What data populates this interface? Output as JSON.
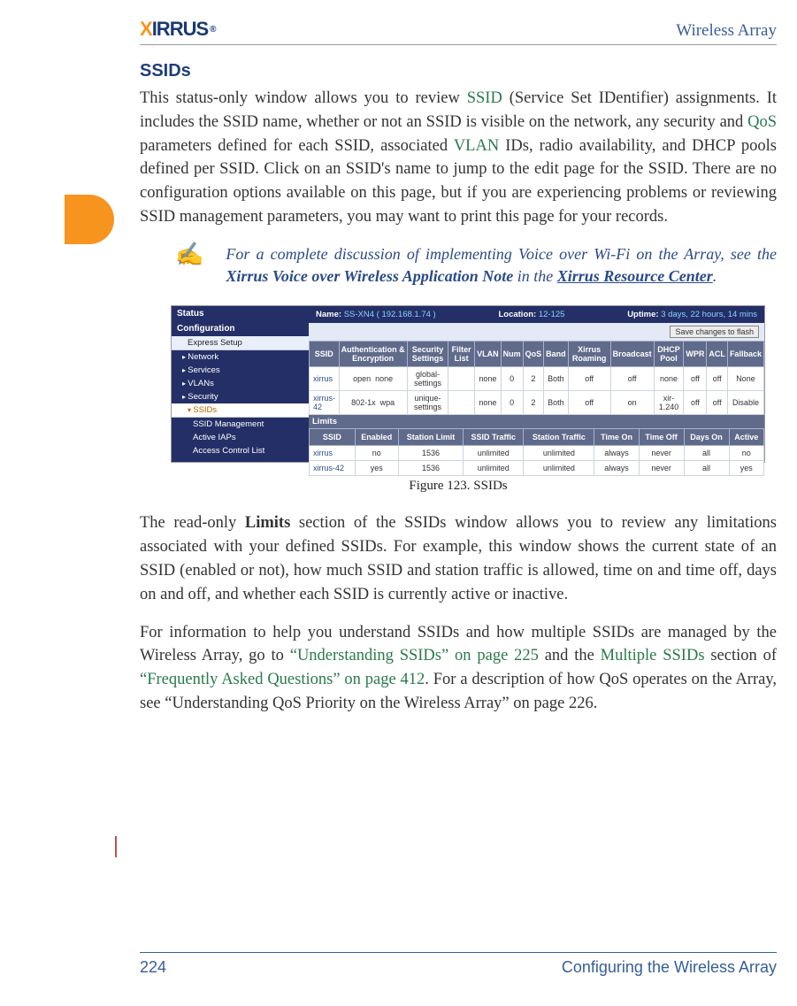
{
  "header": {
    "logo_prefix": "X",
    "logo_text": "IRRUS",
    "logo_sup": "®",
    "doc_title": "Wireless Array"
  },
  "section_title": "SSIDs",
  "para1_pre": "This status-only window allows you to review ",
  "para1_link1": "SSID",
  "para1_mid1": " (Service Set IDentifier) assignments. It includes the SSID name, whether or not an SSID is visible on the network, any security and ",
  "para1_link2": "QoS",
  "para1_mid2": " parameters defined for each SSID, associated ",
  "para1_link3": "VLAN",
  "para1_post": " IDs, radio availability, and DHCP pools defined per SSID. Click on an SSID's name to jump to the edit page for the SSID. There are no configuration options available on this page, but if you are experiencing problems or reviewing SSID management parameters, you may want to print this page for your records.",
  "note": {
    "pre": "For a complete discussion of implementing Voice over Wi-Fi on the Array, see the ",
    "bold1": "Xirrus Voice over Wireless Application Note",
    "mid": " in the ",
    "bold2": "Xirrus Resource Center",
    "post": "."
  },
  "figure": {
    "status_bar": {
      "name_label": "Name:",
      "name": "SS-XN4 ( 192.168.1.74 )",
      "loc_label": "Location:",
      "loc": "12-125",
      "up_label": "Uptime:",
      "up": "3 days, 22 hours, 14 mins"
    },
    "flash_btn": "Save changes to flash",
    "sidebar": {
      "status": "Status",
      "config": "Configuration",
      "express": "Express Setup",
      "network": "Network",
      "services": "Services",
      "vlans": "VLANs",
      "security": "Security",
      "ssids": "SSIDs",
      "ssid_mgmt": "SSID Management",
      "active_iaps": "Active IAPs",
      "acl": "Access Control List"
    },
    "t1_headers": [
      "SSID",
      "Authentication & Encryption",
      "Security Settings",
      "Filter List",
      "VLAN",
      "Num",
      "QoS",
      "Band",
      "Xirrus Roaming",
      "Broadcast",
      "DHCP Pool",
      "WPR",
      "ACL",
      "Fallback"
    ],
    "t1_rows": [
      [
        "xirrus",
        "open",
        "none",
        "global-settings",
        "",
        "none",
        "0",
        "2",
        "Both",
        "off",
        "off",
        "none",
        "off",
        "off",
        "None"
      ],
      [
        "xirrus-42",
        "802-1x",
        "wpa",
        "unique-settings",
        "",
        "none",
        "0",
        "2",
        "Both",
        "off",
        "on",
        "xir-1.240",
        "off",
        "off",
        "Disable"
      ]
    ],
    "limits_label": "Limits",
    "t2_headers": [
      "SSID",
      "Enabled",
      "Station Limit",
      "SSID Traffic",
      "Station Traffic",
      "Time On",
      "Time Off",
      "Days On",
      "Active"
    ],
    "t2_rows": [
      [
        "xirrus",
        "no",
        "1536",
        "unlimited",
        "unlimited",
        "always",
        "never",
        "all",
        "no"
      ],
      [
        "xirrus-42",
        "yes",
        "1536",
        "unlimited",
        "unlimited",
        "always",
        "never",
        "all",
        "yes"
      ]
    ]
  },
  "figcap": "Figure 123. SSIDs",
  "para2_pre": "The read-only ",
  "para2_bold": "Limits",
  "para2_post": " section of the SSIDs window allows you to review any limitations associated with your defined SSIDs. For example, this window shows the current state of an SSID (enabled or not), how much SSID and station traffic is allowed, time on and time off, days on and off, and whether each SSID is currently active or inactive.",
  "para3_pre": "For information to help you understand SSIDs and how multiple SSIDs are managed by the Wireless Array, go to ",
  "para3_link1": "“Understanding SSIDs” on page 225",
  "para3_mid1": " and the ",
  "para3_link2": "Multiple SSIDs",
  "para3_mid2": " section of ",
  "para3_link3": "“Frequently Asked Questions” on page 412",
  "para3_post": ". For a description of how QoS operates on the Array, see “Understanding QoS Priority on the Wireless Array” on page 226.",
  "footer": {
    "page": "224",
    "chapter": "Configuring the Wireless Array"
  }
}
